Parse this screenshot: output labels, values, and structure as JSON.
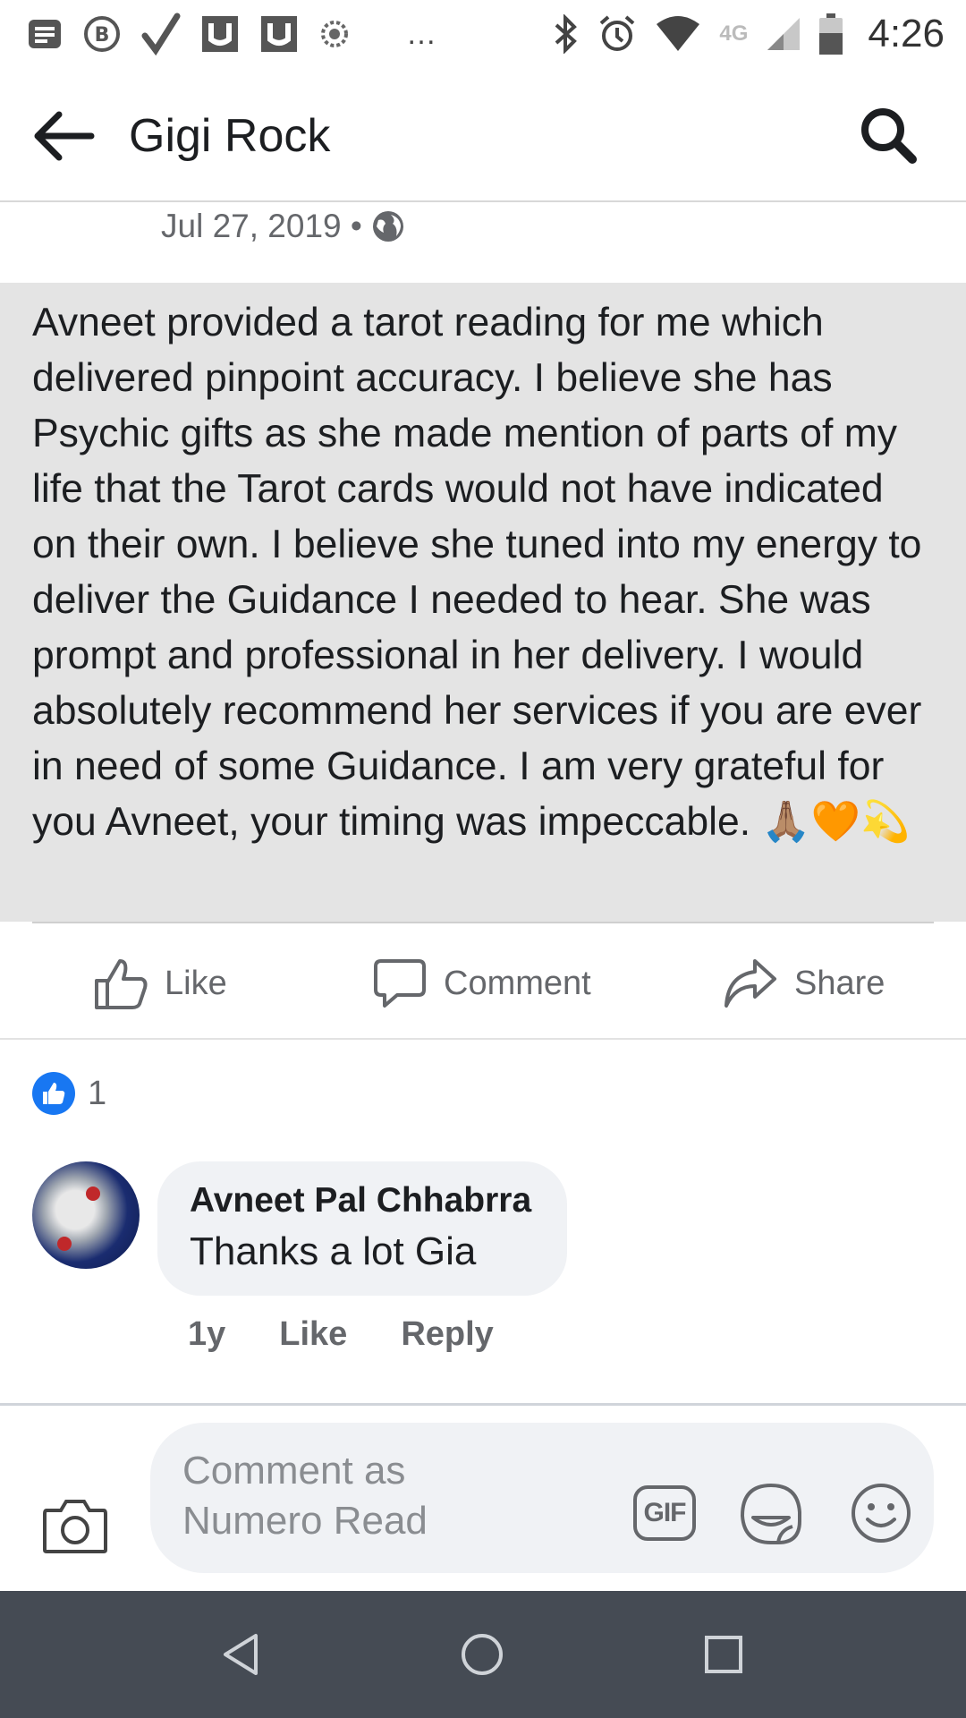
{
  "status_bar": {
    "time": "4:26",
    "network": "4G",
    "overflow": "…",
    "icons": [
      "notes-icon",
      "b-app-icon",
      "check-icon",
      "u-icon",
      "u-icon",
      "spinner-icon",
      "bluetooth-icon",
      "alarm-icon",
      "wifi-icon",
      "signal-icon",
      "battery-icon"
    ]
  },
  "header": {
    "title": "Gigi Rock",
    "back_icon": "arrow-left-icon",
    "search_icon": "search-icon"
  },
  "post": {
    "date": "Jul 27, 2019 •",
    "privacy_icon": "globe-icon",
    "text": "Avneet provided a tarot reading for me which delivered pinpoint accuracy. I believe she has Psychic gifts as she made mention of parts of my life that the Tarot cards would not have indicated on their own. I believe she tuned into my energy to deliver the Guidance I needed to hear. She was prompt and professional in her delivery. I would absolutely recommend her services if you are ever in need of some Guidance. I am very grateful for you Avneet, your timing was impeccable. 🙏🏽🧡💫"
  },
  "actions": {
    "like": "Like",
    "comment": "Comment",
    "share": "Share"
  },
  "reactions": {
    "count": "1"
  },
  "comment": {
    "author": "Avneet Pal Chhabrra",
    "text": "Thanks a lot Gia",
    "time": "1y",
    "like": "Like",
    "reply": "Reply"
  },
  "composer": {
    "placeholder": "Comment as Numero Read",
    "gif": "GIF"
  },
  "colors": {
    "accent": "#1877f2",
    "post_bg": "#e4e4e4",
    "secondary_text": "#65676b",
    "navbar": "#454b54"
  }
}
